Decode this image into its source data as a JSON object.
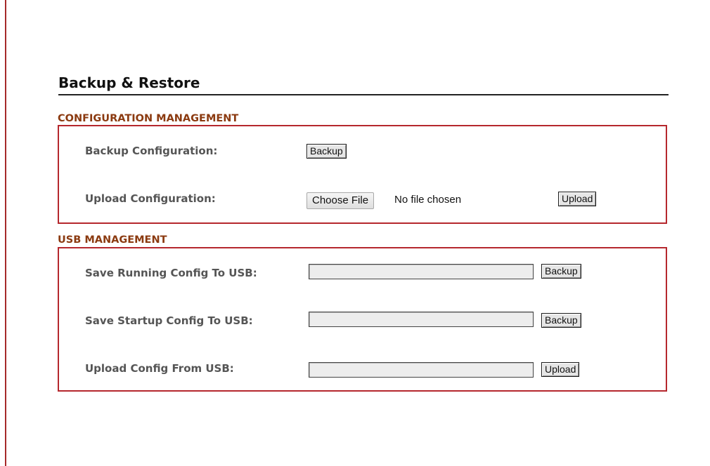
{
  "page": {
    "title": "Backup & Restore"
  },
  "config_management": {
    "title": "CONFIGURATION MANAGEMENT",
    "backup_label": "Backup Configuration:",
    "backup_button": "Backup",
    "upload_label": "Upload Configuration:",
    "choose_file_button": "Choose File",
    "file_status": "No file chosen",
    "upload_button": "Upload"
  },
  "usb_management": {
    "title": "USB MANAGEMENT",
    "rows": [
      {
        "label": "Save Running Config To USB:",
        "value": "",
        "button": "Backup"
      },
      {
        "label": "Save Startup Config To USB:",
        "value": "",
        "button": "Backup"
      },
      {
        "label": "Upload Config From USB:",
        "value": "",
        "button": "Upload"
      }
    ]
  },
  "colors": {
    "accent_border": "#b5272d",
    "section_title": "#8b3a10",
    "left_rule": "#a52a2a"
  }
}
